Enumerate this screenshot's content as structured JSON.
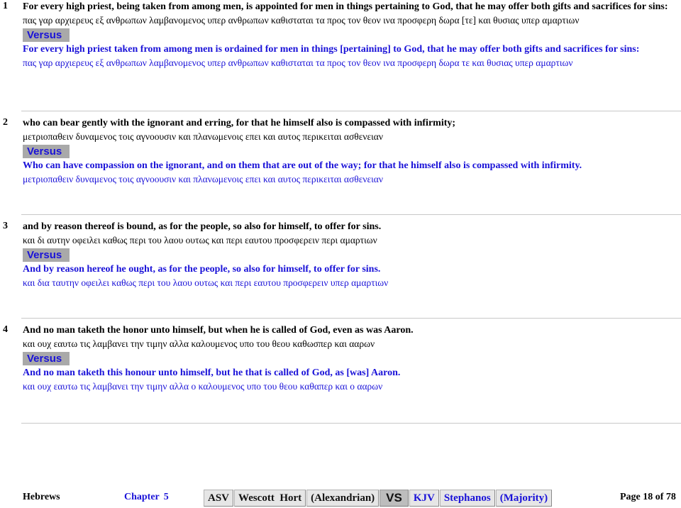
{
  "verses": [
    {
      "num": "1",
      "source_en": "For every high priest, being taken from among men, is appointed for men in things pertaining to God, that he may offer both gifts and sacrifices for sins:",
      "source_gr": "πας γαρ αρχιερευς εξ ανθρωπων λαμβανομενος υπερ ανθρωπων καθισταται τα προς τον θεον ινα προσφερη δωρα [τε] και θυσιας υπερ αμαρτιων",
      "versus_label": "Versus",
      "compare_en": "For every high priest taken from among men is ordained for men in things [pertaining] to God, that he may offer both gifts and sacrifices for sins:",
      "compare_gr": "πας γαρ αρχιερευς εξ ανθρωπων λαμβανομενος υπερ ανθρωπων καθισταται τα προς τον θεον ινα προσφερη δωρα τε και θυσιας υπερ αμαρτιων"
    },
    {
      "num": "2",
      "source_en": "who can bear gently with the ignorant and erring, for that he himself also is compassed with infirmity;",
      "source_gr": "μετριοπαθειν δυναμενος τοις αγνοουσιν και πλανωμενοις επει και αυτος περικειται ασθενειαν",
      "versus_label": "Versus",
      "compare_en": "Who can have compassion on the ignorant, and on them that are out of the way; for that he himself also is compassed with infirmity.",
      "compare_gr": "μετριοπαθειν δυναμενος τοις αγνοουσιν και πλανωμενοις επει και αυτος περικειται ασθενειαν"
    },
    {
      "num": "3",
      "source_en": "and by reason thereof is bound, as for the people, so also for himself, to offer for sins.",
      "source_gr": "και δι αυτην οφειλει καθως περι του λαου ουτως και περι εαυτου προσφερειν περι αμαρτιων",
      "versus_label": "Versus",
      "compare_en": "And by reason hereof he ought, as for the people, so also for himself, to offer for sins.",
      "compare_gr": "και δια ταυτην οφειλει καθως περι του λαου ουτως και περι εαυτου προσφερειν υπερ αμαρτιων"
    },
    {
      "num": "4",
      "source_en": "And no man taketh the honor unto himself, but when he is called of God, even as was Aaron.",
      "source_gr": "και ουχ εαυτω τις λαμβανει την τιμην αλλα καλουμενος υπο του θεου καθωσπερ και ααρων",
      "versus_label": "Versus",
      "compare_en": "And no man taketh this honour unto himself, but he that is called of God, as [was] Aaron.",
      "compare_gr": "και ουχ εαυτω τις λαμβανει την τιμην αλλα ο καλουμενος υπο του θεου καθαπερ και ο ααρων"
    }
  ],
  "footer": {
    "book": "Hebrews",
    "chapter_label": "Chapter",
    "chapter_num": "5",
    "tabs": {
      "asv": "ASV",
      "wescott_hort": "Wescott  Hort",
      "alexandrian": "(Alexandrian)",
      "vs": "VS",
      "kjv": "KJV",
      "stephanos": "Stephanos",
      "majority": "(Majority)"
    },
    "page_label": "Page 18 of 78"
  },
  "colors": {
    "compare_text": "#1a12d8",
    "versus_bg": "#a9a9a9",
    "tab_bg": "#e6e6e6"
  }
}
